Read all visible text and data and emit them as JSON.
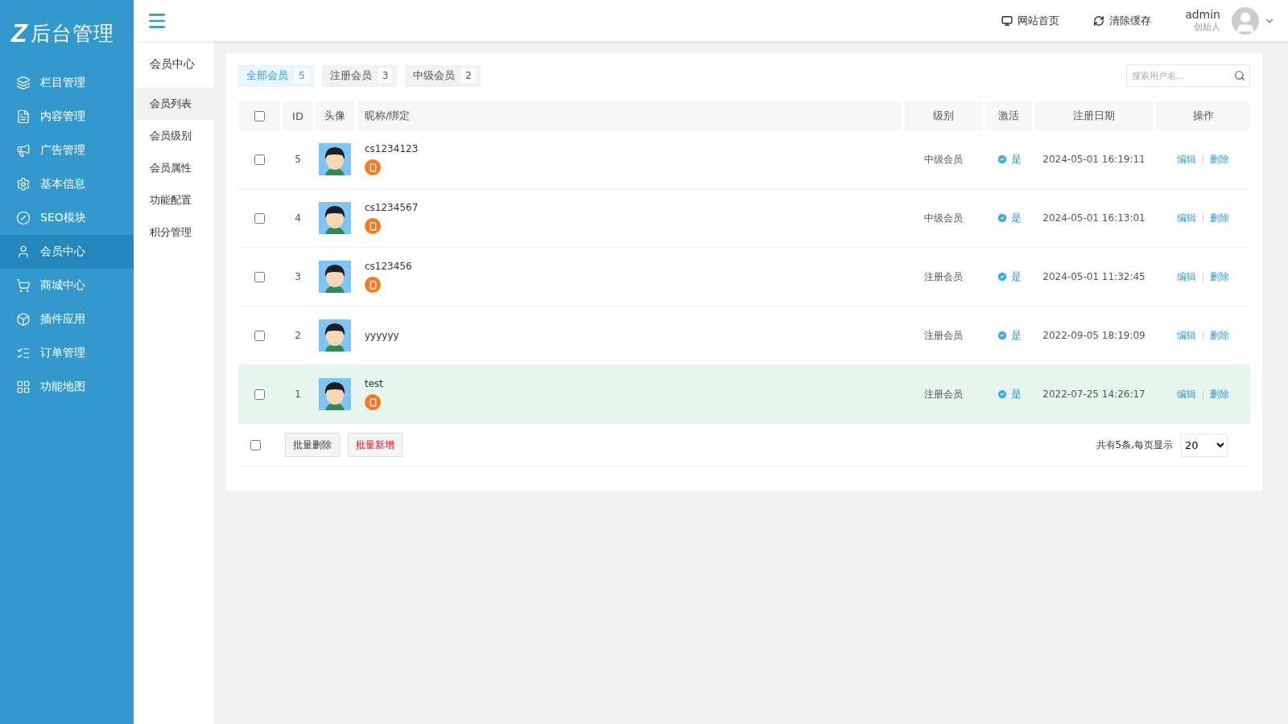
{
  "logo": {
    "mark": "Z",
    "title": "后台管理"
  },
  "sidebar": {
    "items": [
      {
        "label": "栏目管理",
        "selected": false
      },
      {
        "label": "内容管理",
        "selected": false
      },
      {
        "label": "广告管理",
        "selected": false
      },
      {
        "label": "基本信息",
        "selected": false
      },
      {
        "label": "SEO模块",
        "selected": false
      },
      {
        "label": "会员中心",
        "selected": true
      },
      {
        "label": "商城中心",
        "selected": false
      },
      {
        "label": "插件应用",
        "selected": false
      },
      {
        "label": "订单管理",
        "selected": false
      },
      {
        "label": "功能地图",
        "selected": false
      }
    ]
  },
  "header": {
    "links": [
      "网站首页",
      "清除缓存"
    ],
    "user": {
      "name": "admin",
      "role": "创始人"
    }
  },
  "subnav": {
    "title": "会员中心",
    "items": [
      {
        "label": "会员列表",
        "selected": true
      },
      {
        "label": "会员级别",
        "selected": false
      },
      {
        "label": "会员属性",
        "selected": false
      },
      {
        "label": "功能配置",
        "selected": false
      },
      {
        "label": "积分管理",
        "selected": false
      }
    ]
  },
  "filter_tabs": [
    {
      "label": "全部会员",
      "count": "5",
      "selected": true
    },
    {
      "label": "注册会员",
      "count": "3",
      "selected": false
    },
    {
      "label": "中级会员",
      "count": "2",
      "selected": false
    }
  ],
  "search": {
    "placeholder": "搜索用户名..."
  },
  "table": {
    "select_all_checked": false,
    "columns": [
      "ID",
      "头像",
      "昵称/绑定",
      "级别",
      "激活",
      "注册日期",
      "操作"
    ],
    "rows": [
      {
        "checked": false,
        "id": "5",
        "name": "cs1234123",
        "phone_bound": true,
        "level": "中级会员",
        "active": "是",
        "date": "2024-05-01 16:19:11",
        "actions": [
          "编辑",
          "删除"
        ],
        "highlighted": false
      },
      {
        "checked": false,
        "id": "4",
        "name": "cs1234567",
        "phone_bound": true,
        "level": "中级会员",
        "active": "是",
        "date": "2024-05-01 16:13:01",
        "actions": [
          "编辑",
          "删除"
        ],
        "highlighted": false
      },
      {
        "checked": false,
        "id": "3",
        "name": "cs123456",
        "phone_bound": true,
        "level": "注册会员",
        "active": "是",
        "date": "2024-05-01 11:32:45",
        "actions": [
          "编辑",
          "删除"
        ],
        "highlighted": false
      },
      {
        "checked": false,
        "id": "2",
        "name": "yyyyyy",
        "phone_bound": false,
        "level": "注册会员",
        "active": "是",
        "date": "2022-09-05 18:19:09",
        "actions": [
          "编辑",
          "删除"
        ],
        "highlighted": false
      },
      {
        "checked": false,
        "id": "1",
        "name": "test",
        "phone_bound": true,
        "level": "注册会员",
        "active": "是",
        "date": "2022-07-25 14:26:17",
        "actions": [
          "编辑",
          "删除"
        ],
        "highlighted": true
      }
    ]
  },
  "footer": {
    "checked": false,
    "buttons": [
      {
        "label": "批量删除",
        "kind": "normal"
      },
      {
        "label": "批量新增",
        "kind": "danger"
      }
    ],
    "summary": "共有5条,每页显示",
    "page_size": "20"
  }
}
